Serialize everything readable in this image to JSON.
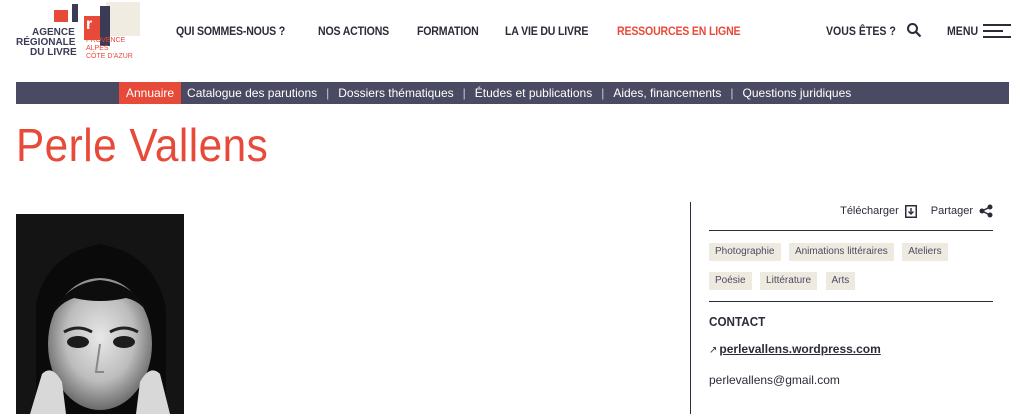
{
  "logo": {
    "line1": "AGENCE",
    "line2": "RÉGIONALE",
    "line3": "DU LIVRE",
    "region1": "PROVENCE",
    "region2": "ALPES",
    "region3": "CÔTE D'AZUR",
    "letter": "r"
  },
  "topnav": {
    "items": [
      {
        "label": "QUI SOMMES-NOUS ?"
      },
      {
        "label": "NOS ACTIONS"
      },
      {
        "label": "FORMATION"
      },
      {
        "label": "LA VIE DU LIVRE"
      },
      {
        "label": "RESSOURCES EN LIGNE"
      }
    ],
    "vous": "VOUS ÊTES ?",
    "menu": "MENU"
  },
  "subnav": {
    "items": [
      {
        "label": "Annuaire"
      },
      {
        "label": "Catalogue des parutions"
      },
      {
        "label": "Dossiers thématiques"
      },
      {
        "label": "Études et publications"
      },
      {
        "label": "Aides, financements"
      },
      {
        "label": "Questions juridiques"
      }
    ],
    "separator": "|"
  },
  "page": {
    "title": "Perle Vallens"
  },
  "sidebar": {
    "download": "Télécharger",
    "share": "Partager",
    "tags": [
      "Photographie",
      "Animations littéraires",
      "Ateliers",
      "Poésie",
      "Littérature",
      "Arts"
    ],
    "contact_heading": "CONTACT",
    "website_arrow": "↗",
    "website": "perlevallens.wordpress.com",
    "email": "perlevallens@gmail.com"
  },
  "colors": {
    "accent": "#e84a3a",
    "navbar": "#4b4a63",
    "text": "#2b2b3a",
    "tag_bg": "#efeadf"
  }
}
